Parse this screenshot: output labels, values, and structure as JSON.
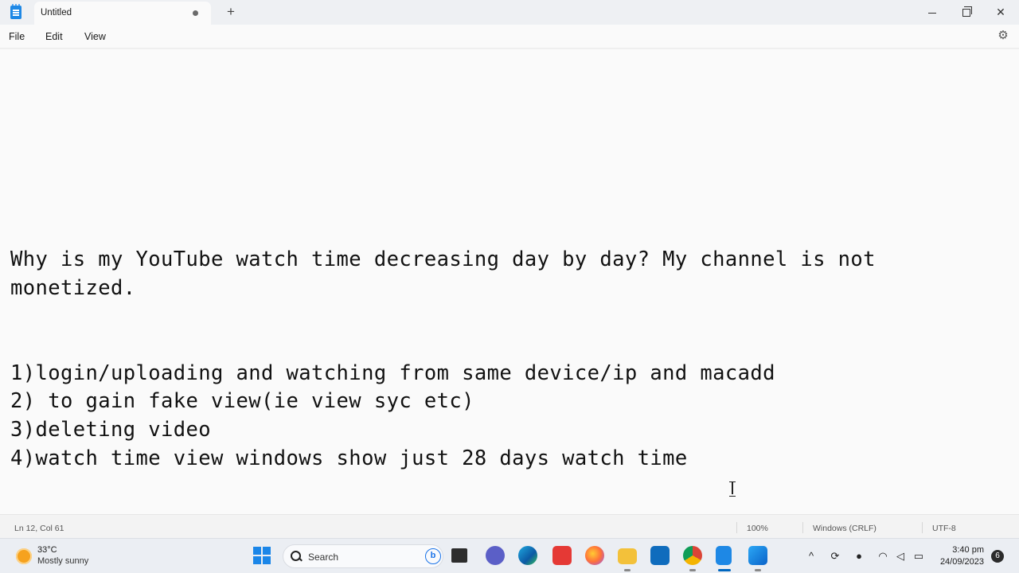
{
  "window": {
    "tab_title": "Untitled",
    "new_tab_symbol": "+",
    "close_symbol": "✕"
  },
  "menu": {
    "file": "File",
    "edit": "Edit",
    "view": "View"
  },
  "editor": {
    "lines": [
      "Why is my YouTube watch time decreasing day by day? My channel is not",
      "monetized.",
      "1)login/uploading and watching from same device/ip and macadd",
      "2) to gain fake view(ie view syc etc)",
      "3)deleting video",
      "4)watch time view windows show just 28 days watch time"
    ]
  },
  "status": {
    "position": "Ln 12, Col 61",
    "zoom": "100%",
    "line_ending": "Windows (CRLF)",
    "encoding": "UTF-8"
  },
  "taskbar": {
    "weather_temp": "33°C",
    "weather_desc": "Mostly sunny",
    "search_placeholder": "Search",
    "bing_label": "b",
    "clock_time": "3:40 pm",
    "clock_date": "24/09/2023",
    "notification_count": "6",
    "icons": [
      "windows-start-icon",
      "search-icon",
      "file-explorer-mini-icon",
      "teams-icon",
      "edge-icon",
      "app-red-icon",
      "firefox-icon",
      "folder-icon",
      "outlook-icon",
      "chrome-icon",
      "notepad-icon",
      "paint-icon"
    ]
  },
  "colors": {
    "accent": "#0067c0",
    "start_blue": "#1b86e8"
  }
}
